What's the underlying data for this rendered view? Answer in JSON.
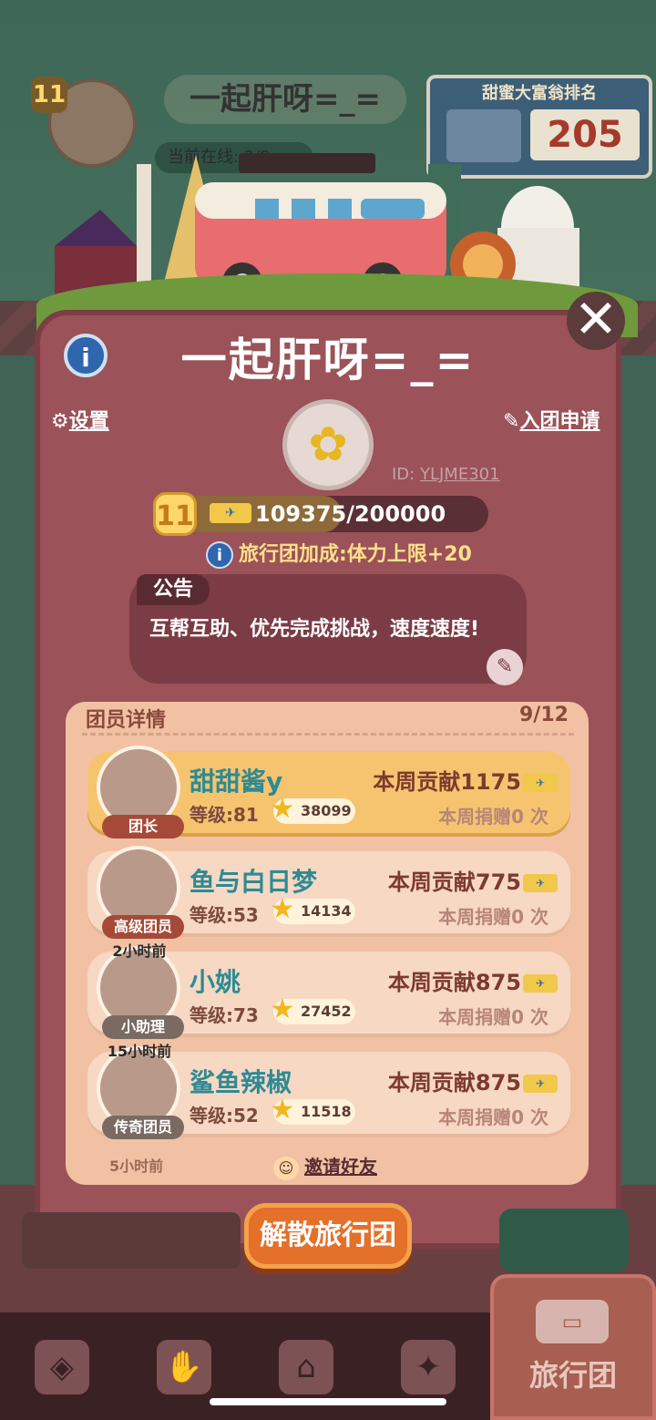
{
  "background": {
    "guild_level": "11",
    "guild_name": "一起肝呀=_=",
    "online_label": "当前在线: 2/9",
    "rank_card": {
      "title": "甜蜜大富翁排名",
      "rank": "205"
    }
  },
  "dialog": {
    "title": "一起肝呀=_=",
    "settings_label": "设置",
    "apply_label": "入团申请",
    "guild_id_prefix": "ID:",
    "guild_id": "YLJME301",
    "level": "11",
    "xp_text": "109375/200000",
    "xp_fraction": 0.547,
    "bonus_text": "旅行团加成:体力上限+20",
    "notice_title": "公告",
    "notice_text": "互帮互助、优先完成挑战，速度速度!",
    "members_title": "团员详情",
    "members_count": "9/12",
    "invite_label": "邀请好友",
    "next_member_peek": "5小时前",
    "disband_label": "解散旅行团"
  },
  "members": [
    {
      "name": "甜甜酱y",
      "level": "等级:81",
      "points": "38099",
      "contribution": "本周贡献1175",
      "donation": "本周捐赠0 次",
      "role": "团长",
      "last_seen": ""
    },
    {
      "name": "鱼与白日梦",
      "level": "等级:53",
      "points": "14134",
      "contribution": "本周贡献775",
      "donation": "本周捐赠0 次",
      "role": "高级团员",
      "last_seen": ""
    },
    {
      "name": "小姚",
      "level": "等级:73",
      "points": "27452",
      "contribution": "本周贡献875",
      "donation": "本周捐赠0 次",
      "role": "小助理",
      "last_seen": "2小时前"
    },
    {
      "name": "鲨鱼辣椒",
      "level": "等级:52",
      "points": "11518",
      "contribution": "本周贡献875",
      "donation": "本周捐赠0 次",
      "role": "传奇团员",
      "last_seen": "15小时前"
    }
  ],
  "nav": {
    "items": [
      "shop-bag-icon",
      "hands-icon",
      "bell-icon",
      "map-pin-icon"
    ],
    "active_label": "旅行团"
  },
  "colors": {
    "accent": "#e4702a",
    "panel": "#9b5258",
    "member_name": "#2e8a95"
  }
}
